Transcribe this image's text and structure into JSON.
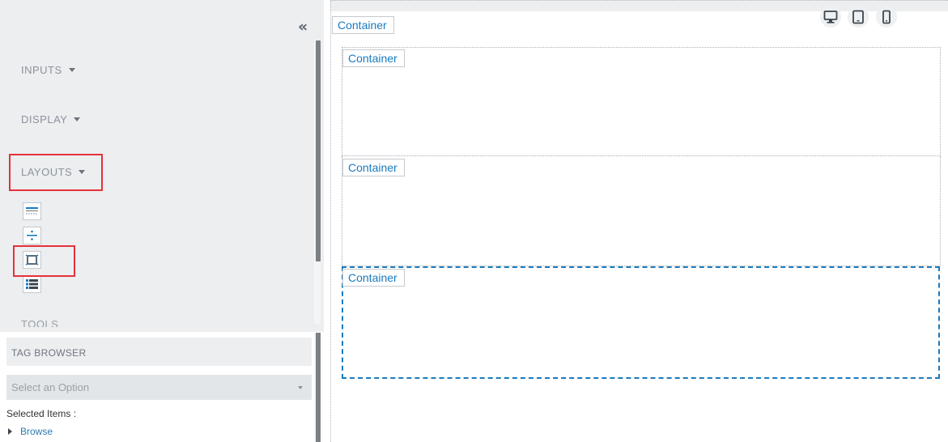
{
  "sidebar": {
    "collapse_glyph": "«",
    "sections": {
      "inputs": "INPUTS",
      "display": "DISPLAY",
      "layouts": "LAYOUTS",
      "tools": "TOOLS"
    },
    "layout_tools": [
      "horizontal-rule-icon",
      "divider-icon",
      "container-icon",
      "list-layout-icon"
    ]
  },
  "tag_browser": {
    "title": "TAG BROWSER",
    "select_placeholder": "Select an Option",
    "selected_label": "Selected Items :",
    "browse_label": "Browse"
  },
  "canvas": {
    "containers": [
      "Container",
      "Container",
      "Container",
      "Container"
    ],
    "device_buttons": [
      "desktop-icon",
      "tablet-icon",
      "phone-icon"
    ]
  },
  "colors": {
    "accent": "#1a7bbf",
    "highlight": "#e5313b",
    "panel": "#eceef0"
  }
}
